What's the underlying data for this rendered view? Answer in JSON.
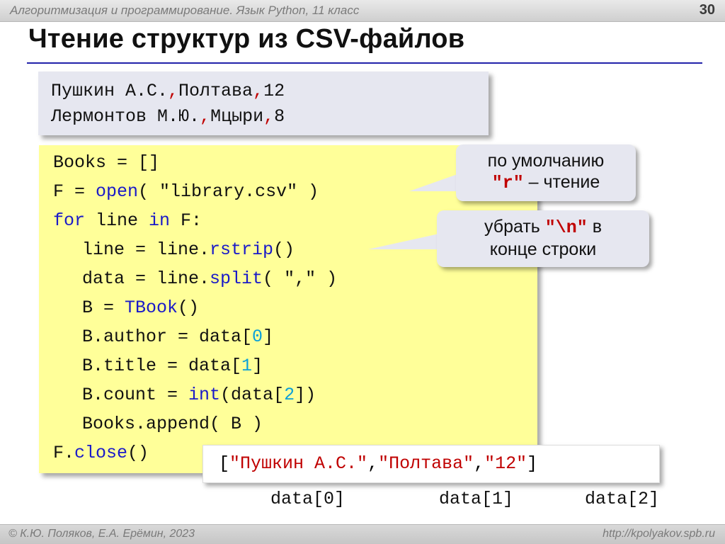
{
  "header": {
    "course": "Алгоритмизация и программирование. Язык Python, 11 класс",
    "page": "30"
  },
  "title": "Чтение структур из CSV-файлов",
  "csv": {
    "lines": [
      {
        "name": "Пушкин А.С.",
        "comma1": ",",
        "title": "Полтава",
        "comma2": ",",
        "count": "12"
      },
      {
        "name": "Лермонтов М.Ю.",
        "comma1": ",",
        "title": "Мцыри",
        "comma2": ",",
        "count": "8"
      }
    ]
  },
  "code": {
    "l1": "Books = []",
    "l2": {
      "a": "F = ",
      "kw": "open",
      "b": "( ",
      "s": "\"library.csv\"",
      "c": " )"
    },
    "l3": {
      "kw1": "for",
      "a": " line ",
      "kw2": "in",
      "b": " F:"
    },
    "l4": {
      "a": "line = line.",
      "kw": "rstrip",
      "b": "()"
    },
    "l5": {
      "a": "data = line.",
      "kw": "split",
      "b": "( ",
      "s": "\",\"",
      "c": " )"
    },
    "l6": {
      "a": "B = ",
      "kw": "TBook",
      "b": "()"
    },
    "l7": {
      "a": "B.author = data[",
      "n": "0",
      "b": "]"
    },
    "l8": {
      "a": "B.title = data[",
      "n": "1",
      "b": "]"
    },
    "l9": {
      "a": "B.count = ",
      "kw": "int",
      "b": "(data[",
      "n": "2",
      "c": "])"
    },
    "l10": "Books.append( B )",
    "l11": {
      "a": "F.",
      "kw": "close",
      "b": "()"
    }
  },
  "callout_open": {
    "line1": "по умолчанию",
    "mode": "\"r\"",
    "line2_rest": " – чтение"
  },
  "callout_strip": {
    "pre": "убрать ",
    "esc": "\"\\n\"",
    "post": " в",
    "line2": "конце строки"
  },
  "result": {
    "open": "[",
    "v0": "\"Пушкин А.С.\"",
    "sep1": ",",
    "v1": "\"Полтава\"",
    "sep2": ",",
    "v2": "\"12\"",
    "close": "]"
  },
  "indices": [
    "data[0]",
    "data[1]",
    "data[2]"
  ],
  "footer": {
    "authors": "© К.Ю. Поляков, Е.А. Ерёмин, 2023",
    "url": "http://kpolyakov.spb.ru"
  }
}
